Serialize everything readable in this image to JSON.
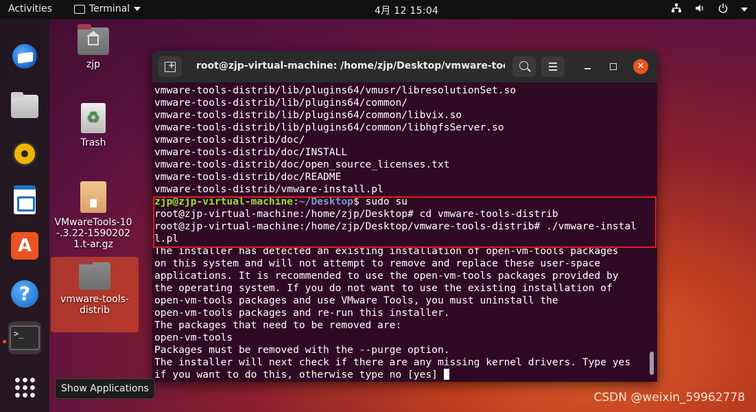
{
  "topbar": {
    "activities": "Activities",
    "app_name": "Terminal",
    "clock": "4月 12  15:04"
  },
  "dock": {
    "items": [
      "thunderbird-icon",
      "files-icon",
      "rhythmbox-icon",
      "writer-icon",
      "software-icon",
      "help-icon",
      "terminal-icon",
      "show-apps-icon"
    ],
    "help_glyph": "?",
    "store_glyph": "A",
    "terminal_glyph": ">_"
  },
  "desktop": {
    "icons": [
      {
        "label": "zjp"
      },
      {
        "label": "Trash"
      },
      {
        "label": "VMwareTools-10-.3.22-15902021.t-ar.gz"
      },
      {
        "label": "vmware-tools-distrib"
      }
    ]
  },
  "tooltip": {
    "text": "Show Applications"
  },
  "window": {
    "title": "root@zjp-virtual-machine: /home/zjp/Desktop/vmware-tools...",
    "close_glyph": "✕"
  },
  "terminal": {
    "lines_before": [
      "vmware-tools-distrib/lib/plugins64/vmusr/libresolutionSet.so",
      "vmware-tools-distrib/lib/plugins64/common/",
      "vmware-tools-distrib/lib/plugins64/common/libvix.so",
      "vmware-tools-distrib/lib/plugins64/common/libhgfsServer.so",
      "vmware-tools-distrib/doc/",
      "vmware-tools-distrib/doc/INSTALL",
      "vmware-tools-distrib/doc/open_source_licenses.txt",
      "vmware-tools-distrib/doc/README",
      "vmware-tools-distrib/vmware-install.pl"
    ],
    "prompt": {
      "user_host": "zjp@zjp-virtual-machine",
      "sep": ":",
      "path": "~/Desktop",
      "cmd": "$ sudo su"
    },
    "root_lines": [
      "root@zjp-virtual-machine:/home/zjp/Desktop# cd vmware-tools-distrib",
      "root@zjp-virtual-machine:/home/zjp/Desktop/vmware-tools-distrib# ./vmware-instal",
      "l.pl"
    ],
    "lines_after": [
      "The installer has detected an existing installation of open-vm-tools packages",
      "on this system and will not attempt to remove and replace these user-space",
      "applications. It is recommended to use the open-vm-tools packages provided by",
      "the operating system. If you do not want to use the existing installation of",
      "open-vm-tools packages and use VMware Tools, you must uninstall the",
      "open-vm-tools packages and re-run this installer.",
      "The packages that need to be removed are:",
      "open-vm-tools",
      "Packages must be removed with the --purge option.",
      "The installer will next check if there are any missing kernel drivers. Type yes"
    ],
    "last_line": "if you want to do this, otherwise type no [yes] "
  },
  "watermark": "CSDN @weixin_59962778"
}
